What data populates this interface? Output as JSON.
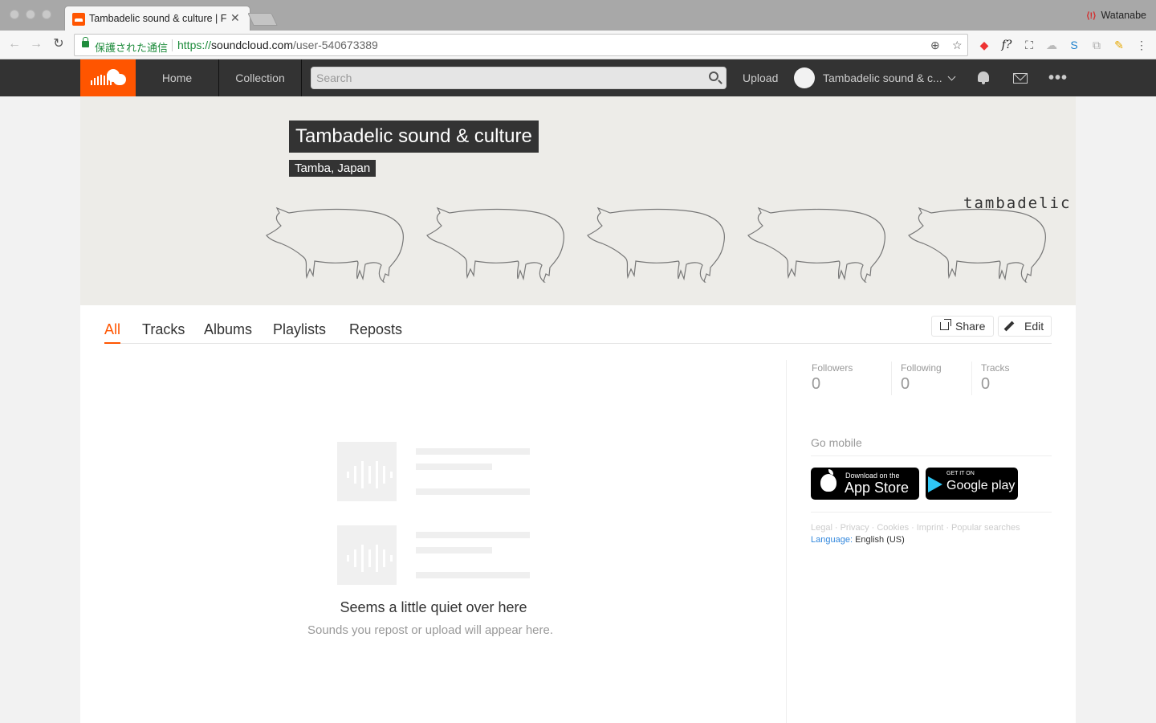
{
  "browser": {
    "tab_title": "Tambadelic sound & culture | Free Listening on SoundCloud",
    "profile_name": "Watanabe",
    "security_label": "保護された通信",
    "url_scheme": "https://",
    "url_host": "soundcloud.com",
    "url_path": "/user-540673389"
  },
  "nav": {
    "home": "Home",
    "collection": "Collection",
    "search_placeholder": "Search",
    "upload": "Upload",
    "user_name": "Tambadelic sound & c..."
  },
  "profile": {
    "name": "Tambadelic sound & culture",
    "location": "Tamba, Japan",
    "banner_text": "tambadelic"
  },
  "tabs": [
    "All",
    "Tracks",
    "Albums",
    "Playlists",
    "Reposts"
  ],
  "actions": {
    "share": "Share",
    "edit": "Edit"
  },
  "empty_state": {
    "title": "Seems a little quiet over here",
    "subtitle": "Sounds you repost or upload will appear here."
  },
  "stats": [
    {
      "label": "Followers",
      "value": "0"
    },
    {
      "label": "Following",
      "value": "0"
    },
    {
      "label": "Tracks",
      "value": "0"
    }
  ],
  "sidebar": {
    "go_mobile": "Go mobile",
    "app_store_small": "Download on the",
    "app_store_big": "App Store",
    "google_small": "GET IT ON",
    "google_big": "Google play"
  },
  "footer": {
    "links": [
      "Legal",
      "Privacy",
      "Cookies",
      "Imprint",
      "Popular searches"
    ],
    "language_label": "Language:",
    "language_value": "English (US)"
  },
  "colors": {
    "brand": "#ff5500",
    "header": "#333333",
    "banner": "#edece8"
  }
}
